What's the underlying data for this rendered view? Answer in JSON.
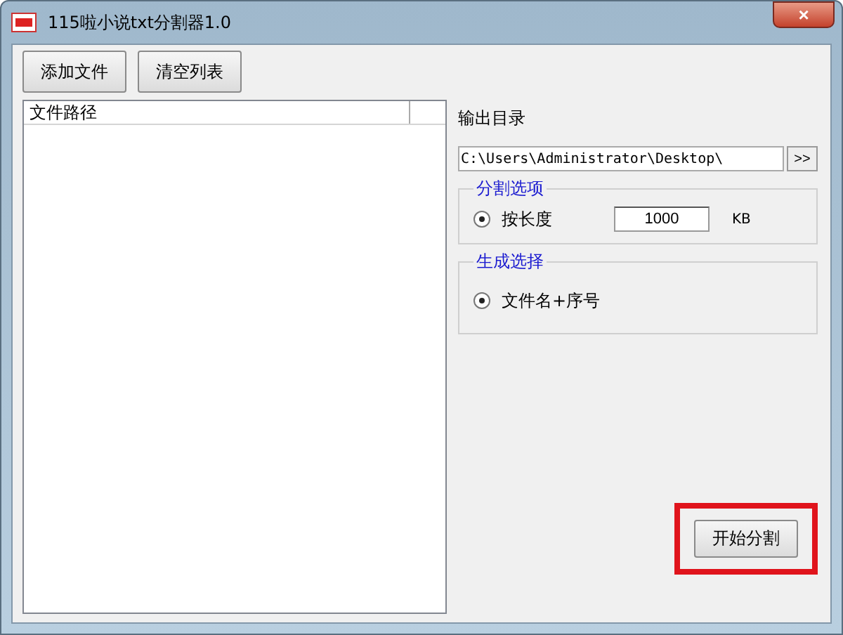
{
  "window": {
    "title": "115啦小说txt分割器1.0",
    "close": "×"
  },
  "toolbar": [
    "添加文件",
    "清空列表"
  ],
  "file_list": {
    "columns": [
      "文件路径"
    ]
  },
  "output": {
    "label": "输出目录",
    "value": "C:\\Users\\Administrator\\Desktop\\",
    "browse": ">>"
  },
  "split_options": {
    "title": "分割选项",
    "options": [
      {
        "label": "按长度",
        "selected": true,
        "value": "1000",
        "unit": "KB"
      }
    ]
  },
  "generate_options": {
    "title": "生成选择",
    "options": [
      {
        "label": "文件名+序号",
        "selected": true
      }
    ]
  },
  "start_button": {
    "label": "开始分割",
    "highlighted": true
  }
}
